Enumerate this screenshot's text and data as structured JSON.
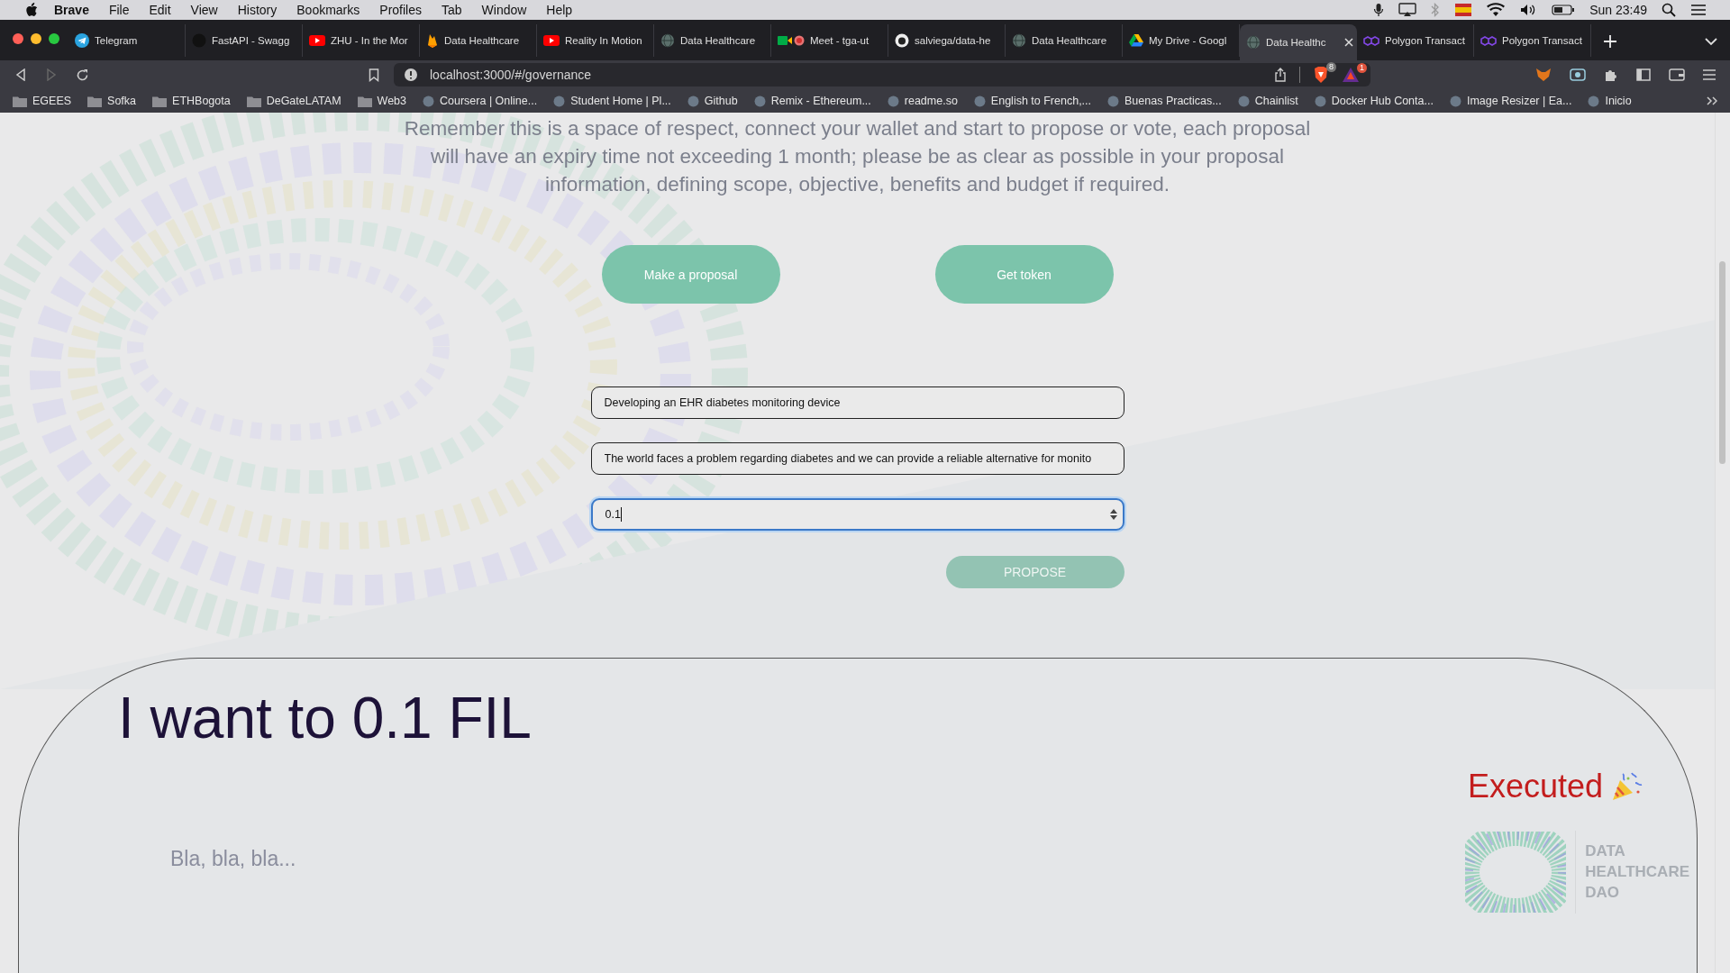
{
  "menu_bar": {
    "app": "Brave",
    "items": [
      "File",
      "Edit",
      "View",
      "History",
      "Bookmarks",
      "Profiles",
      "Tab",
      "Window",
      "Help"
    ],
    "clock": "Sun 23:49"
  },
  "tabs": [
    {
      "title": "Telegram",
      "selected": false
    },
    {
      "title": "FastAPI - Swagg",
      "selected": false
    },
    {
      "title": "ZHU - In the Mor",
      "selected": false
    },
    {
      "title": "Data Healthcare",
      "selected": false
    },
    {
      "title": "Reality In Motion",
      "selected": false
    },
    {
      "title": "Data Healthcare",
      "selected": false
    },
    {
      "title": "Meet - tga-ut",
      "selected": false
    },
    {
      "title": "salviega/data-he",
      "selected": false
    },
    {
      "title": "Data Healthcare",
      "selected": false
    },
    {
      "title": "My Drive - Googl",
      "selected": false
    },
    {
      "title": "Data Healthc",
      "selected": true
    },
    {
      "title": "Polygon Transact",
      "selected": false
    },
    {
      "title": "Polygon Transact",
      "selected": false
    }
  ],
  "toolbar": {
    "url": "localhost:3000/#/governance",
    "shield_count": "8",
    "alert_count": "1"
  },
  "bookmarks": [
    {
      "title": "EGEES",
      "kind": "folder"
    },
    {
      "title": "Sofka",
      "kind": "folder"
    },
    {
      "title": "ETHBogota",
      "kind": "folder"
    },
    {
      "title": "DeGateLATAM",
      "kind": "folder"
    },
    {
      "title": "Web3",
      "kind": "folder"
    },
    {
      "title": "Coursera | Online...",
      "kind": "site"
    },
    {
      "title": "Student Home | Pl...",
      "kind": "site"
    },
    {
      "title": "Github",
      "kind": "site"
    },
    {
      "title": "Remix - Ethereum...",
      "kind": "site"
    },
    {
      "title": "readme.so",
      "kind": "site"
    },
    {
      "title": "English to French,...",
      "kind": "site"
    },
    {
      "title": "Buenas Practicas...",
      "kind": "site"
    },
    {
      "title": "Chainlist",
      "kind": "site"
    },
    {
      "title": "Docker Hub Conta...",
      "kind": "site"
    },
    {
      "title": "Image Resizer | Ea...",
      "kind": "site"
    },
    {
      "title": "Inicio",
      "kind": "site"
    }
  ],
  "intro_lines": [
    "Remember this is a space of respect, connect your wallet and start to propose or vote, each proposal",
    "will have an expiry time not exceeding 1 month; please be as clear as possible in your proposal",
    "information, defining scope, objective, benefits and budget if required."
  ],
  "actions": [
    "Make a proposal",
    "Get token"
  ],
  "form": {
    "fields": [
      {
        "value": "Developing an EHR diabetes monitoring device",
        "kind": "text",
        "focused": false
      },
      {
        "value": "The world faces a problem regarding diabetes and we can provide a reliable alternative for monito",
        "kind": "text",
        "focused": false
      },
      {
        "value": "0.1",
        "kind": "number",
        "focused": true
      }
    ],
    "submit": {
      "label": "PROPOSE",
      "disabled": true
    }
  },
  "proposal": {
    "title": "I want to 0.1 FIL",
    "status": "Executed",
    "description": "Bla, bla, bla...",
    "logo_lines": [
      "**D**ATA",
      "**H**EALTHCARE",
      "**D**AO"
    ]
  }
}
